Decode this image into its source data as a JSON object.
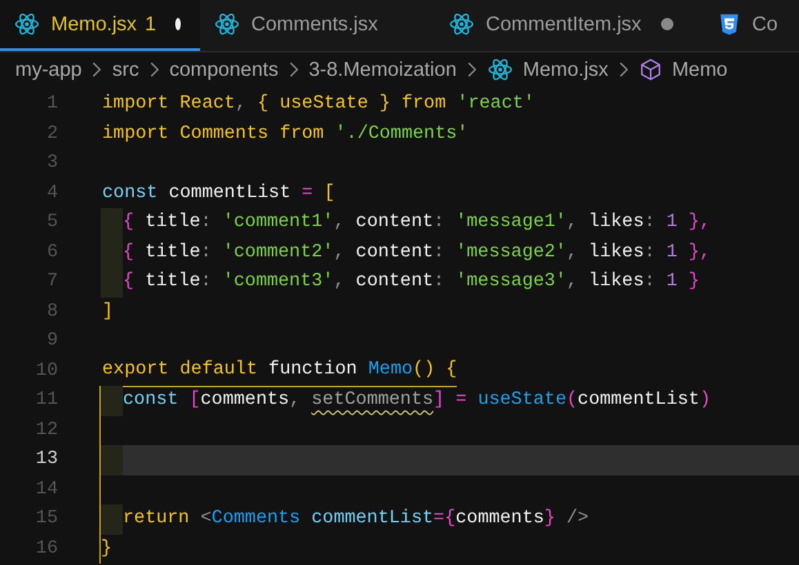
{
  "tabs": [
    {
      "label": "Memo.jsx",
      "kind": "react",
      "badge": "1",
      "modified": true,
      "selected": true
    },
    {
      "label": "Comments.jsx",
      "kind": "react",
      "modified": false,
      "selected": false
    },
    {
      "label": "CommentItem.jsx",
      "kind": "react",
      "modified": true,
      "selected": false
    },
    {
      "label": "Co",
      "kind": "css",
      "modified": false,
      "selected": false
    }
  ],
  "breadcrumbs": [
    {
      "label": "my-app",
      "kind": "folder"
    },
    {
      "label": "src",
      "kind": "folder"
    },
    {
      "label": "components",
      "kind": "folder"
    },
    {
      "label": "3-8.Memoization",
      "kind": "folder"
    },
    {
      "label": "Memo.jsx",
      "kind": "react"
    },
    {
      "label": "Memo",
      "kind": "symbol"
    }
  ],
  "lines": [
    {
      "number": "1",
      "tokens": [
        {
          "text": "import React",
          "kind": "keyword"
        },
        {
          "text": ", ",
          "kind": "punct"
        },
        {
          "text": "{ useState }",
          "kind": "keyword"
        },
        {
          "text": " from ",
          "kind": "keyword"
        },
        {
          "text": "'react'",
          "kind": "string"
        }
      ]
    },
    {
      "number": "2",
      "tokens": [
        {
          "text": "import Comments from ",
          "kind": "keyword"
        },
        {
          "text": "'./Comments'",
          "kind": "string"
        }
      ]
    },
    {
      "number": "3"
    },
    {
      "number": "4",
      "tokens": [
        {
          "text": "const",
          "kind": "storage"
        },
        {
          "text": " commentList ",
          "kind": "plain"
        },
        {
          "text": "=",
          "kind": "operator"
        },
        {
          "text": " [",
          "kind": "keyword"
        }
      ]
    },
    {
      "number": "5",
      "indented": true,
      "tokens": [
        {
          "text": "{",
          "kind": "operator"
        },
        {
          "text": " title",
          "kind": "plain"
        },
        {
          "text": ": ",
          "kind": "punct"
        },
        {
          "text": "'comment1'",
          "kind": "string"
        },
        {
          "text": ", ",
          "kind": "punct"
        },
        {
          "text": "content",
          "kind": "plain"
        },
        {
          "text": ": ",
          "kind": "punct"
        },
        {
          "text": "'message1'",
          "kind": "string"
        },
        {
          "text": ", ",
          "kind": "punct"
        },
        {
          "text": "likes",
          "kind": "plain"
        },
        {
          "text": ": ",
          "kind": "punct"
        },
        {
          "text": "1",
          "kind": "number"
        },
        {
          "text": " },",
          "kind": "operator"
        }
      ]
    },
    {
      "number": "6",
      "indented": true,
      "tokens": [
        {
          "text": "{",
          "kind": "operator"
        },
        {
          "text": " title",
          "kind": "plain"
        },
        {
          "text": ": ",
          "kind": "punct"
        },
        {
          "text": "'comment2'",
          "kind": "string"
        },
        {
          "text": ", ",
          "kind": "punct"
        },
        {
          "text": "content",
          "kind": "plain"
        },
        {
          "text": ": ",
          "kind": "punct"
        },
        {
          "text": "'message2'",
          "kind": "string"
        },
        {
          "text": ", ",
          "kind": "punct"
        },
        {
          "text": "likes",
          "kind": "plain"
        },
        {
          "text": ": ",
          "kind": "punct"
        },
        {
          "text": "1",
          "kind": "number"
        },
        {
          "text": " },",
          "kind": "operator"
        }
      ]
    },
    {
      "number": "7",
      "indented": true,
      "tokens": [
        {
          "text": "{",
          "kind": "operator"
        },
        {
          "text": " title",
          "kind": "plain"
        },
        {
          "text": ": ",
          "kind": "punct"
        },
        {
          "text": "'comment3'",
          "kind": "string"
        },
        {
          "text": ", ",
          "kind": "punct"
        },
        {
          "text": "content",
          "kind": "plain"
        },
        {
          "text": ": ",
          "kind": "punct"
        },
        {
          "text": "'message3'",
          "kind": "string"
        },
        {
          "text": ", ",
          "kind": "punct"
        },
        {
          "text": "likes",
          "kind": "plain"
        },
        {
          "text": ": ",
          "kind": "punct"
        },
        {
          "text": "1",
          "kind": "number"
        },
        {
          "text": " }",
          "kind": "operator"
        }
      ]
    },
    {
      "number": "8",
      "tokens": [
        {
          "text": "]",
          "kind": "keyword"
        }
      ]
    },
    {
      "number": "9"
    },
    {
      "number": "10",
      "scope_open": true,
      "tokens": [
        {
          "text": "export default ",
          "kind": "keyword"
        },
        {
          "text": "function ",
          "kind": "plain"
        },
        {
          "text": "Memo",
          "kind": "function"
        },
        {
          "text": "() {",
          "kind": "keyword"
        }
      ]
    },
    {
      "number": "11",
      "indented": true,
      "in_scope": true,
      "tokens": [
        {
          "text": "const ",
          "kind": "storage"
        },
        {
          "text": "[",
          "kind": "operator"
        },
        {
          "text": "comments",
          "kind": "plain"
        },
        {
          "text": ", ",
          "kind": "punct"
        },
        {
          "text": "setComments",
          "kind": "unused",
          "warning": true
        },
        {
          "text": "]",
          "kind": "operator"
        },
        {
          "text": " = ",
          "kind": "operator"
        },
        {
          "text": "useState",
          "kind": "function"
        },
        {
          "text": "(",
          "kind": "operator"
        },
        {
          "text": "commentList",
          "kind": "plain"
        },
        {
          "text": ")",
          "kind": "operator"
        }
      ]
    },
    {
      "number": "12",
      "in_scope": true
    },
    {
      "number": "13",
      "indented": true,
      "in_scope": true,
      "current": true
    },
    {
      "number": "14",
      "in_scope": true
    },
    {
      "number": "15",
      "indented": true,
      "in_scope": true,
      "tokens": [
        {
          "text": "return ",
          "kind": "keyword"
        },
        {
          "text": "<",
          "kind": "punct"
        },
        {
          "text": "Comments",
          "kind": "function"
        },
        {
          "text": " commentList",
          "kind": "storage"
        },
        {
          "text": "=",
          "kind": "operator"
        },
        {
          "text": "{",
          "kind": "operator"
        },
        {
          "text": "comments",
          "kind": "plain"
        },
        {
          "text": "}",
          "kind": "operator"
        },
        {
          "text": " />",
          "kind": "punct"
        }
      ]
    },
    {
      "number": "16",
      "in_scope": true,
      "tokens": [
        {
          "text": "}",
          "kind": "keyword"
        }
      ]
    }
  ]
}
